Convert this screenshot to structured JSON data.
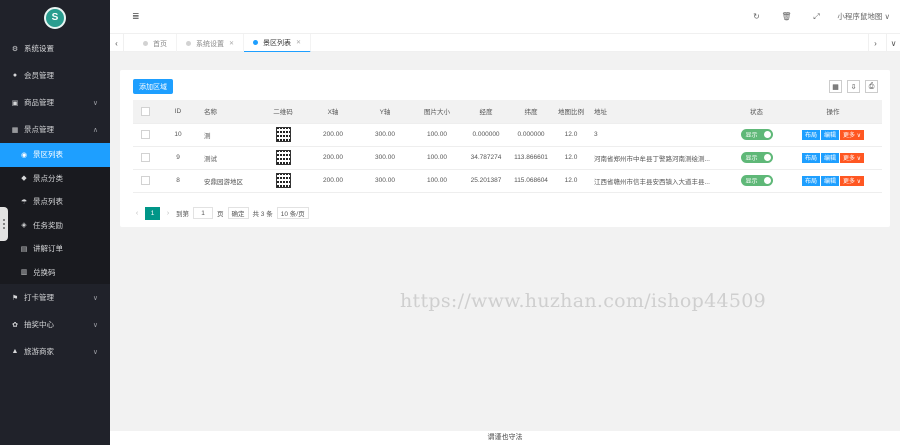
{
  "sidebar": {
    "logo_text": "S",
    "items": [
      {
        "label": "系统设置",
        "icon": "gear-icon"
      },
      {
        "label": "会员管理",
        "icon": "users-icon"
      },
      {
        "label": "商品管理",
        "icon": "cart-icon"
      },
      {
        "label": "景点管理",
        "icon": "grid-icon"
      }
    ],
    "sub_items": [
      {
        "label": "景区列表",
        "icon": "map-pin-icon",
        "active": true
      },
      {
        "label": "景点分类",
        "icon": "tag-icon"
      },
      {
        "label": "景点列表",
        "icon": "list-icon"
      },
      {
        "label": "任务奖励",
        "icon": "shield-icon"
      },
      {
        "label": "讲解订单",
        "icon": "doc-icon"
      },
      {
        "label": "兑换码",
        "icon": "barcode-icon"
      }
    ],
    "bottom_items": [
      {
        "label": "打卡管理",
        "icon": "flag-icon"
      },
      {
        "label": "抽奖中心",
        "icon": "gift-icon"
      },
      {
        "label": "旅游商家",
        "icon": "store-icon"
      }
    ]
  },
  "header": {
    "menu_icon": "≣",
    "user_label": "小程序鼠地图 ∨"
  },
  "tabs": [
    {
      "label": "首页",
      "closable": false,
      "active": false
    },
    {
      "label": "系统设置",
      "closable": true,
      "active": false
    },
    {
      "label": "景区列表",
      "closable": true,
      "active": true
    }
  ],
  "toolbar": {
    "add_label": "添加区域"
  },
  "table": {
    "columns": [
      "ID",
      "名称",
      "二维码",
      "X轴",
      "Y轴",
      "图片大小",
      "经度",
      "纬度",
      "地图比例",
      "地址",
      "状态",
      "操作"
    ],
    "rows": [
      {
        "id": "10",
        "name": "测",
        "x": "200.00",
        "y": "300.00",
        "size": "100.00",
        "lng": "0.000000",
        "lat": "0.000000",
        "scale": "12.0",
        "addr": "3",
        "status": "显示"
      },
      {
        "id": "9",
        "name": "测试",
        "x": "200.00",
        "y": "300.00",
        "size": "100.00",
        "lng": "34.787274",
        "lat": "113.866601",
        "scale": "12.0",
        "addr": "河南省郑州市中牟县丁警路河南测绘测...",
        "status": "显示"
      },
      {
        "id": "8",
        "name": "安鼎园游地区",
        "x": "200.00",
        "y": "300.00",
        "size": "100.00",
        "lng": "25.201387",
        "lat": "115.068604",
        "scale": "12.0",
        "addr": "江西省赣州市信丰县安西镇入大道丰县...",
        "status": "显示"
      }
    ],
    "ops": {
      "layout": "布局",
      "edit": "编辑",
      "more": "更多 ∨"
    }
  },
  "pager": {
    "current": "1",
    "goto_label": "到第",
    "goto_value": "1",
    "page_label": "页",
    "confirm_label": "确定",
    "total_label": "共 3 条",
    "per_page": "10 条/页"
  },
  "watermark": "https://www.huzhan.com/ishop44509",
  "footer": "谓谨也守法"
}
